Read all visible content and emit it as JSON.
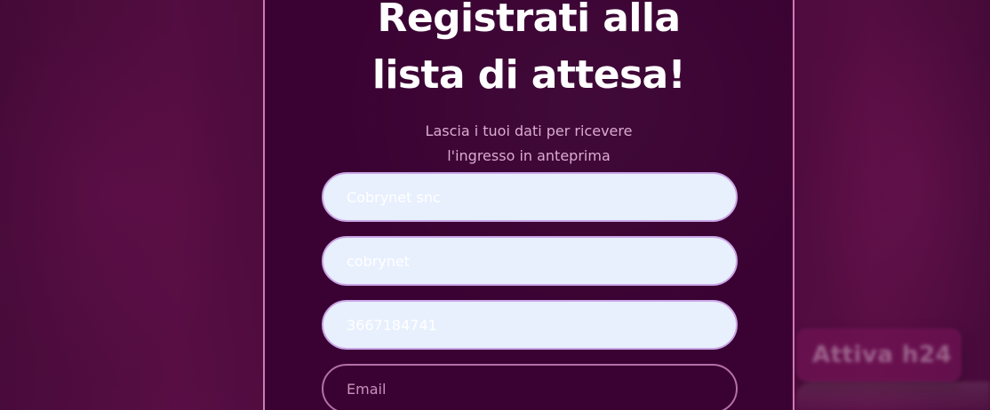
{
  "title": {
    "line1": "Registrati alla",
    "line2": "lista di attesa!"
  },
  "subtitle": {
    "line1": "Lascia i tuoi dati per ricevere",
    "line2": "l'ingresso in anteprima"
  },
  "form": {
    "company_value": "Cobrynet snc",
    "username_value": "cobrynet",
    "phone_value": "3667184741",
    "email_placeholder": "Email"
  },
  "background": {
    "blurred_chip_text": "Attiva h24"
  },
  "colors": {
    "panel_bg": "#3a0232",
    "panel_border": "#d07ab6",
    "field_filled_bg": "#e8f0fe",
    "field_empty_border": "#dc96d2"
  }
}
